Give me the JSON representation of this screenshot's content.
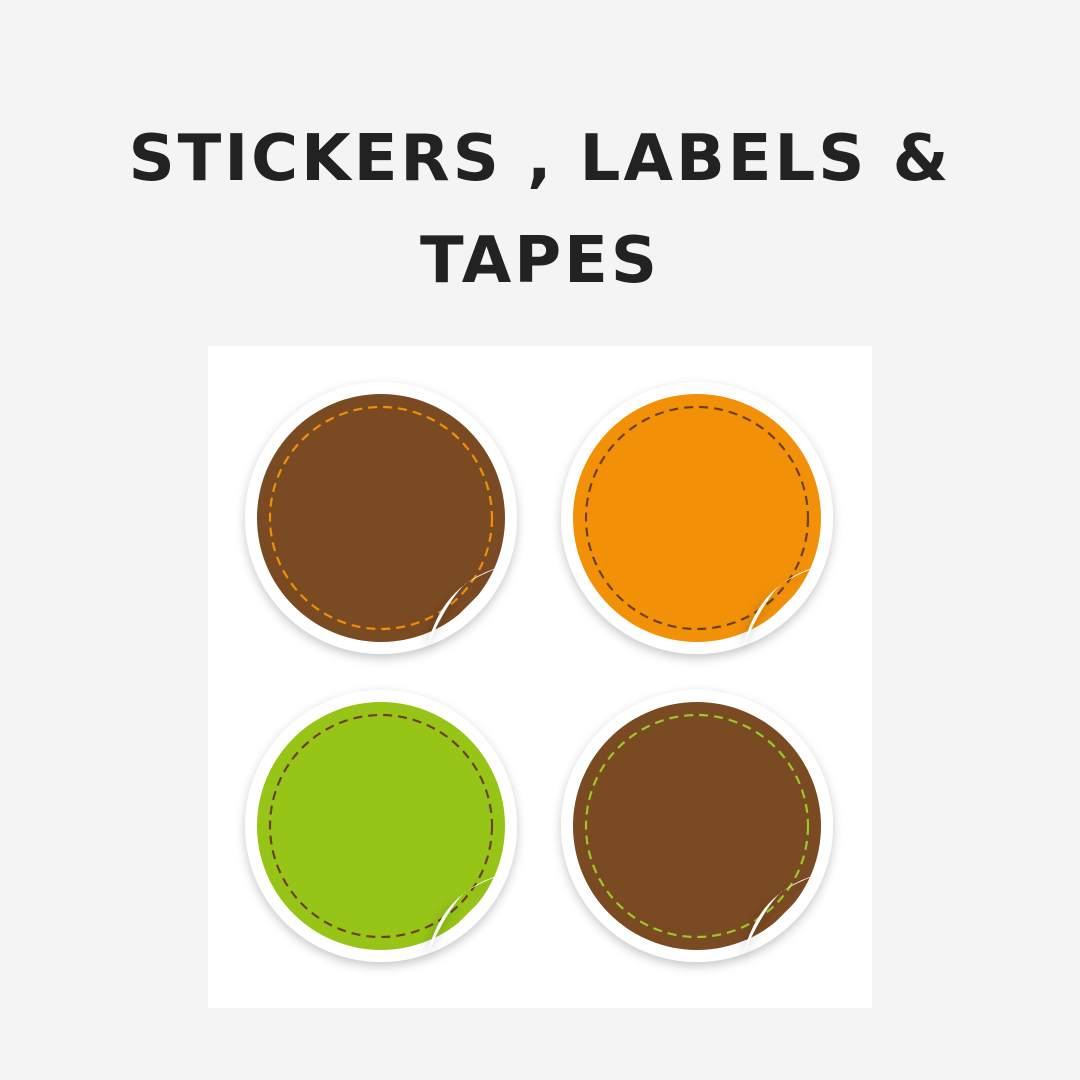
{
  "heading": {
    "line1": "STICKERS , LABELS &",
    "line2": "TAPES"
  },
  "stickers": [
    {
      "name": "sticker-brown-top-left",
      "fill": "#7a4a22",
      "stitch": "#f0900a"
    },
    {
      "name": "sticker-orange-top-right",
      "fill": "#f29108",
      "stitch": "#6e4020"
    },
    {
      "name": "sticker-green-bottom-left",
      "fill": "#96c417",
      "stitch": "#6e4020"
    },
    {
      "name": "sticker-brown-bottom-right",
      "fill": "#7a4a22",
      "stitch": "#9cc82a"
    }
  ],
  "colors": {
    "background": "#f4f4f4",
    "panel": "#ffffff",
    "title": "#222222",
    "sticker_border": "#ffffff"
  }
}
